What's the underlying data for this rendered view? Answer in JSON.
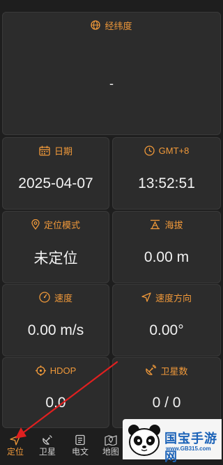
{
  "cards": {
    "latlng": {
      "label": "经纬度",
      "value": "-"
    },
    "date": {
      "label": "日期",
      "value": "2025-04-07"
    },
    "time": {
      "label": "GMT+8",
      "value": "13:52:51"
    },
    "mode": {
      "label": "定位模式",
      "value": "未定位"
    },
    "altitude": {
      "label": "海拔",
      "value": "0.00 m"
    },
    "speed": {
      "label": "速度",
      "value": "0.00 m/s"
    },
    "heading": {
      "label": "速度方向",
      "value": "0.00°"
    },
    "hdop": {
      "label": "HDOP",
      "value": "0.0"
    },
    "satellites": {
      "label": "卫星数",
      "value": "0 / 0"
    }
  },
  "nav": {
    "items": [
      {
        "label": "定位",
        "icon": "navigation-arrow-icon",
        "active": true
      },
      {
        "label": "卫星",
        "icon": "satellite-icon"
      },
      {
        "label": "电文",
        "icon": "document-icon"
      },
      {
        "label": "地图",
        "icon": "map-pin-icon"
      }
    ]
  },
  "watermark": {
    "brand": "国宝手游网",
    "url": "www.GB315.com"
  },
  "colors": {
    "accent": "#f0993a",
    "background": "#1e1e1e",
    "card": "#2c2c2c",
    "text": "#f2f2f2",
    "annotation": "#e02020"
  }
}
